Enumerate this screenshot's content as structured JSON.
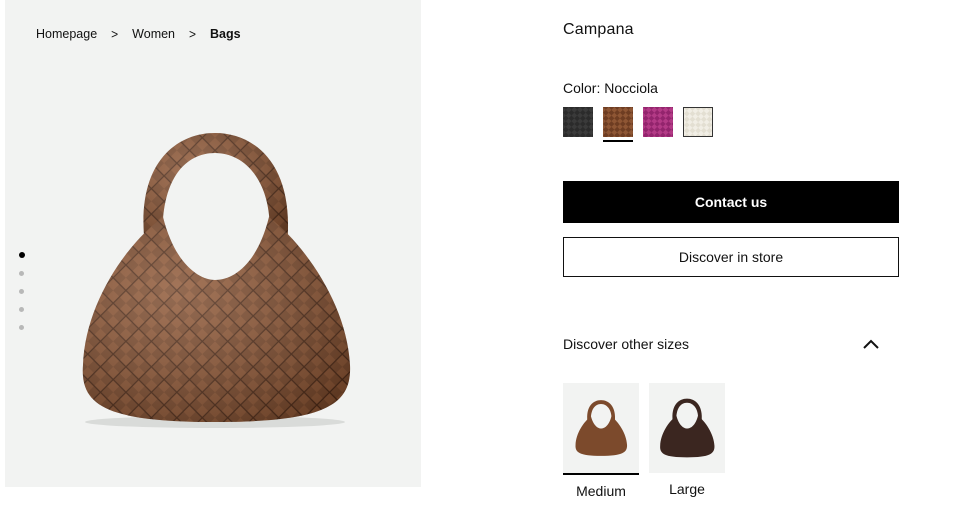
{
  "breadcrumb": {
    "items": [
      "Homepage",
      "Women"
    ],
    "current": "Bags"
  },
  "gallery": {
    "image_count": 5,
    "active_index": 0
  },
  "product": {
    "name": "Campana",
    "color_label": "Color: Nocciola",
    "swatches": [
      {
        "name": "black",
        "color": "#2a2a2a"
      },
      {
        "name": "nocciola",
        "color": "#7a4529",
        "selected": true
      },
      {
        "name": "fuchsia",
        "color": "#a42d7a"
      },
      {
        "name": "cream",
        "color": "#ece8dc"
      }
    ]
  },
  "actions": {
    "contact_label": "Contact us",
    "store_label": "Discover in store"
  },
  "sizes": {
    "header": "Discover other sizes",
    "items": [
      {
        "label": "Medium",
        "selected": true
      },
      {
        "label": "Large"
      }
    ]
  }
}
